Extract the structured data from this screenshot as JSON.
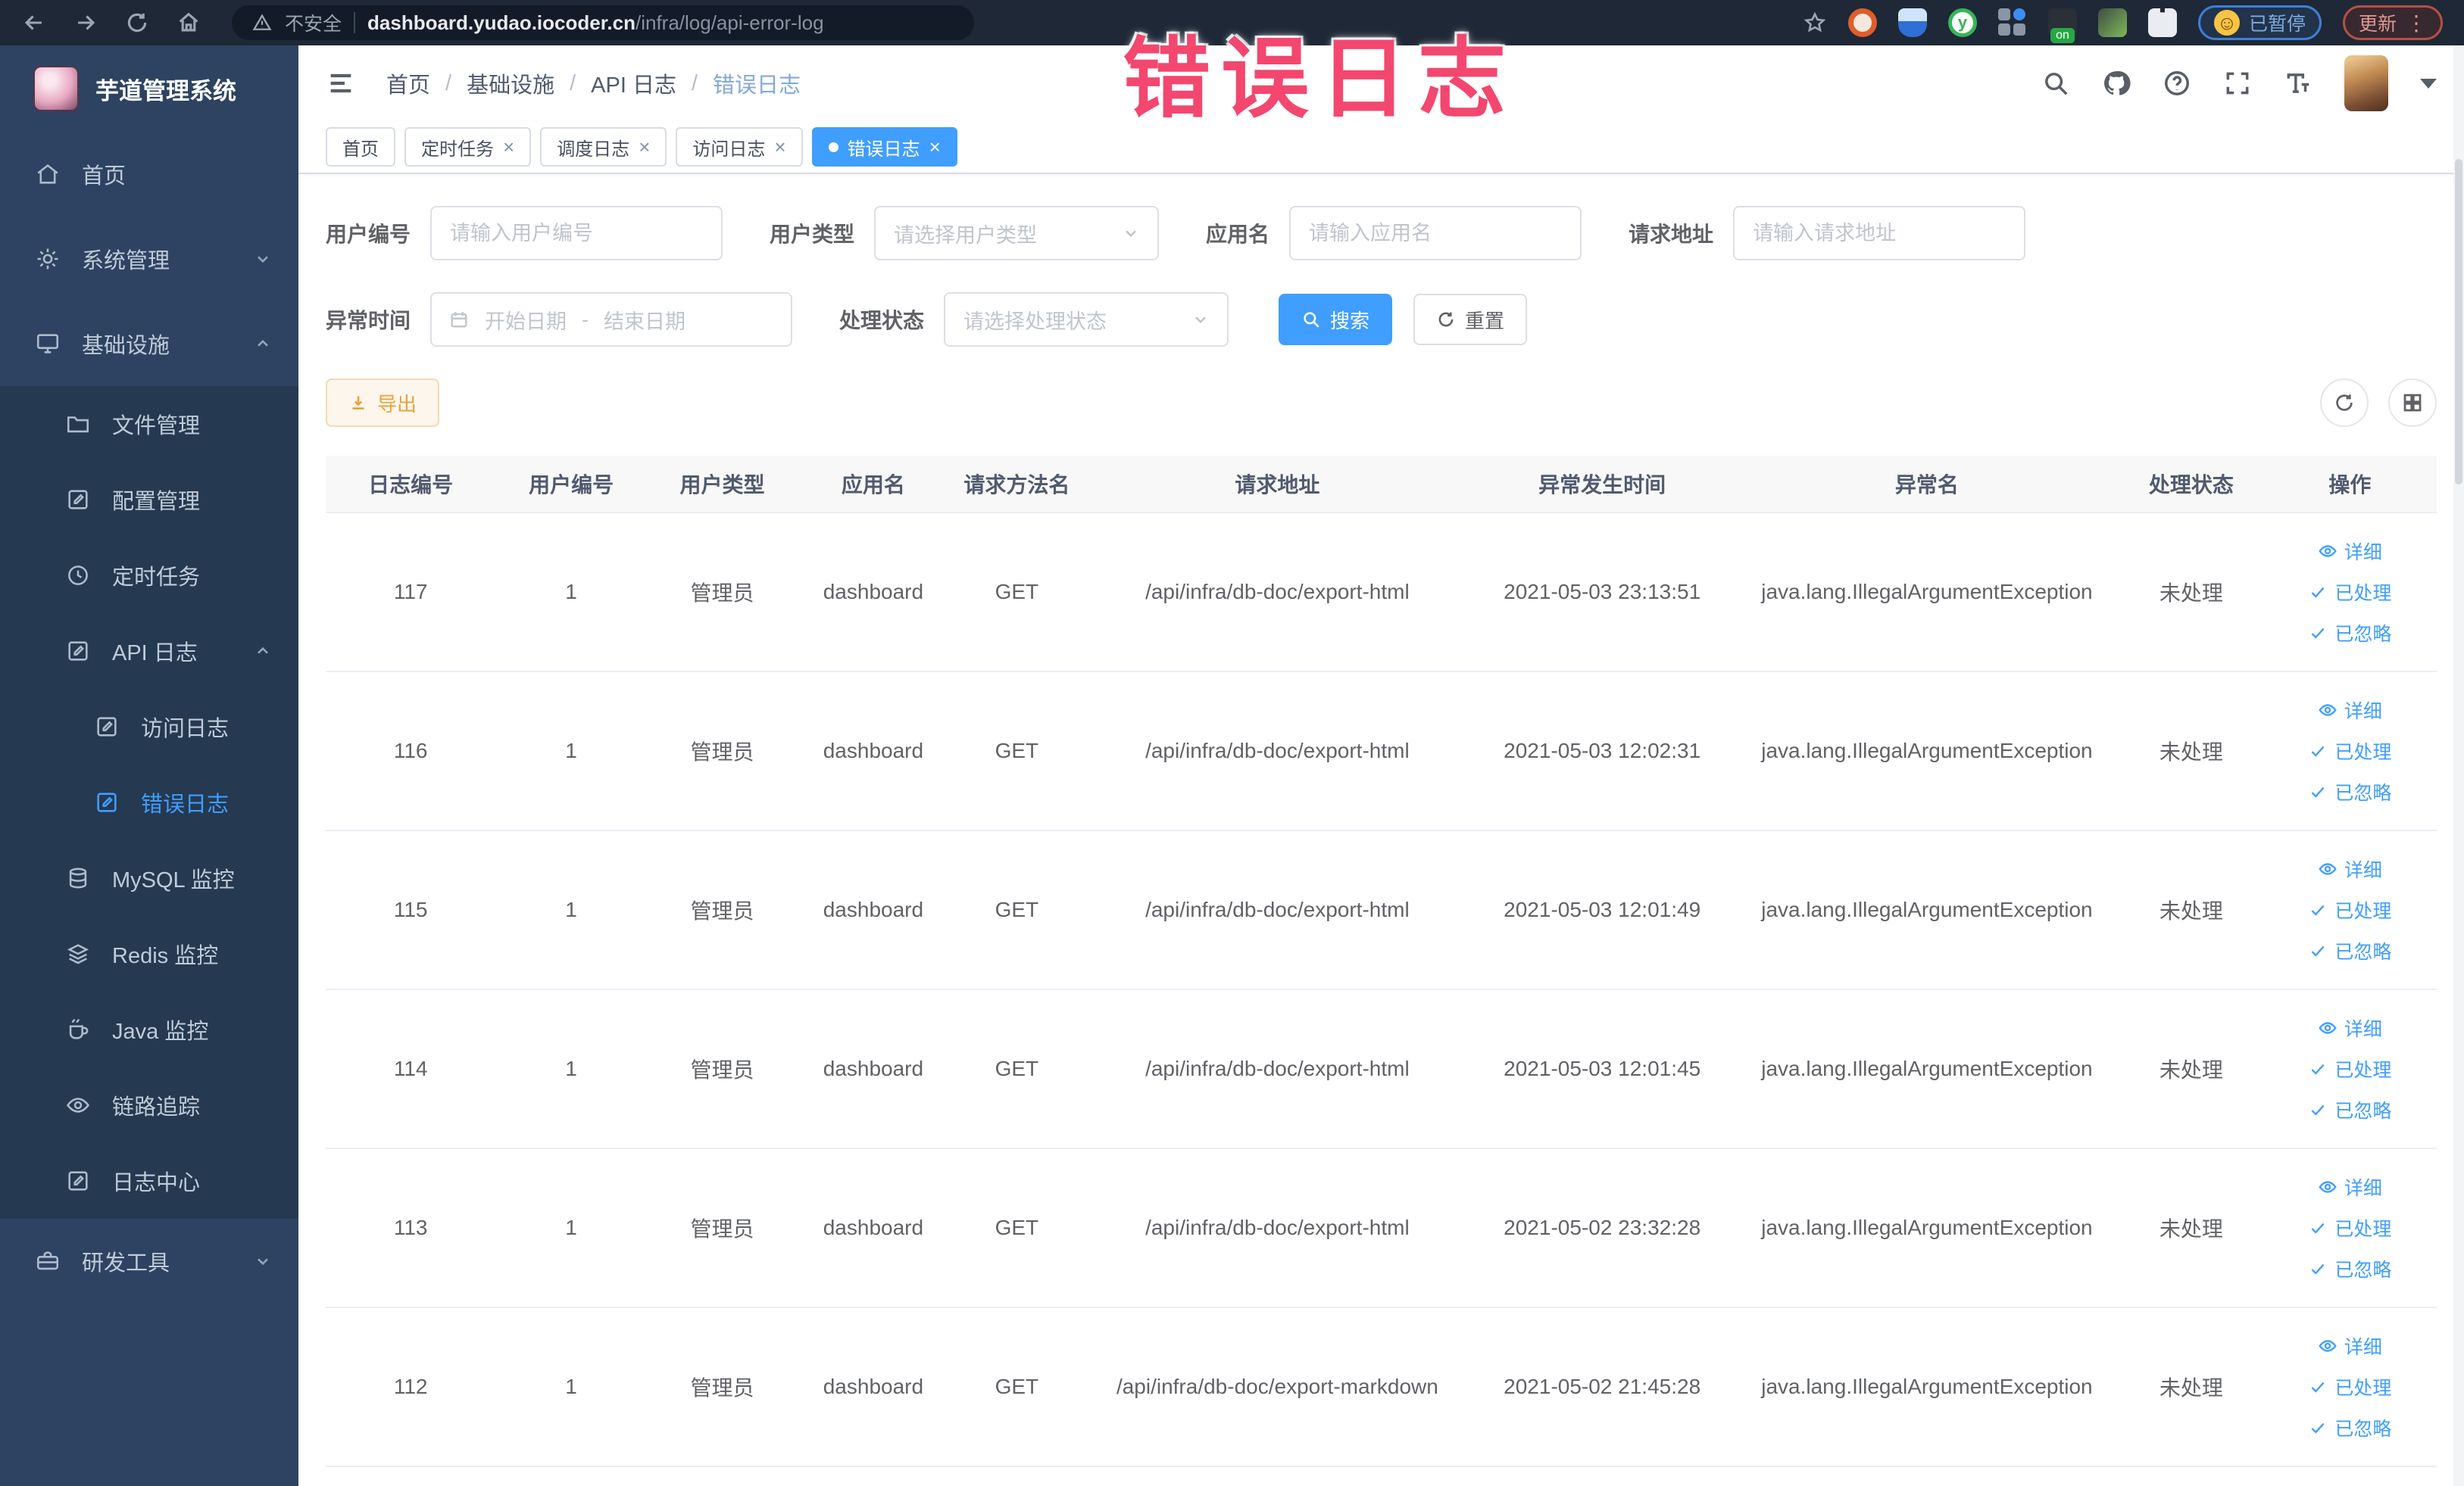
{
  "overlay": {
    "text": "错误日志"
  },
  "browser": {
    "security_text": "不安全",
    "url_host": "dashboard.yudao.iocoder.cn",
    "url_path": "/infra/log/api-error-log",
    "paused_label": "已暂停",
    "update_label": "更新"
  },
  "sidebar": {
    "app_title": "芋道管理系统",
    "items": [
      {
        "label": "首页"
      },
      {
        "label": "系统管理"
      },
      {
        "label": "基础设施"
      },
      {
        "label": "文件管理"
      },
      {
        "label": "配置管理"
      },
      {
        "label": "定时任务"
      },
      {
        "label": "API 日志"
      },
      {
        "label": "访问日志"
      },
      {
        "label": "错误日志"
      },
      {
        "label": "MySQL 监控"
      },
      {
        "label": "Redis 监控"
      },
      {
        "label": "Java 监控"
      },
      {
        "label": "链路追踪"
      },
      {
        "label": "日志中心"
      },
      {
        "label": "研发工具"
      }
    ]
  },
  "breadcrumb": {
    "separator": "/",
    "items": [
      "首页",
      "基础设施",
      "API 日志",
      "错误日志"
    ]
  },
  "tags": [
    {
      "label": "首页"
    },
    {
      "label": "定时任务"
    },
    {
      "label": "调度日志"
    },
    {
      "label": "访问日志"
    },
    {
      "label": "错误日志"
    }
  ],
  "filters": {
    "user_id_label": "用户编号",
    "user_id_placeholder": "请输入用户编号",
    "user_type_label": "用户类型",
    "user_type_placeholder": "请选择用户类型",
    "app_name_label": "应用名",
    "app_name_placeholder": "请输入应用名",
    "request_url_label": "请求地址",
    "request_url_placeholder": "请输入请求地址",
    "time_label": "异常时间",
    "time_start_placeholder": "开始日期",
    "time_separator": "-",
    "time_end_placeholder": "结束日期",
    "status_label": "处理状态",
    "status_placeholder": "请选择处理状态",
    "search_label": "搜索",
    "reset_label": "重置"
  },
  "toolbar": {
    "export_label": "导出"
  },
  "table": {
    "columns": [
      "日志编号",
      "用户编号",
      "用户类型",
      "应用名",
      "请求方法名",
      "请求地址",
      "异常发生时间",
      "异常名",
      "处理状态",
      "操作"
    ],
    "actions": {
      "detail": "详细",
      "processed": "已处理",
      "ignored": "已忽略"
    },
    "rows": [
      {
        "id": "117",
        "user_id": "1",
        "user_type": "管理员",
        "app": "dashboard",
        "method": "GET",
        "url": "/api/infra/db-doc/export-html",
        "time": "2021-05-03 23:13:51",
        "exception": "java.lang.IllegalArgumentException",
        "status": "未处理"
      },
      {
        "id": "116",
        "user_id": "1",
        "user_type": "管理员",
        "app": "dashboard",
        "method": "GET",
        "url": "/api/infra/db-doc/export-html",
        "time": "2021-05-03 12:02:31",
        "exception": "java.lang.IllegalArgumentException",
        "status": "未处理"
      },
      {
        "id": "115",
        "user_id": "1",
        "user_type": "管理员",
        "app": "dashboard",
        "method": "GET",
        "url": "/api/infra/db-doc/export-html",
        "time": "2021-05-03 12:01:49",
        "exception": "java.lang.IllegalArgumentException",
        "status": "未处理"
      },
      {
        "id": "114",
        "user_id": "1",
        "user_type": "管理员",
        "app": "dashboard",
        "method": "GET",
        "url": "/api/infra/db-doc/export-html",
        "time": "2021-05-03 12:01:45",
        "exception": "java.lang.IllegalArgumentException",
        "status": "未处理"
      },
      {
        "id": "113",
        "user_id": "1",
        "user_type": "管理员",
        "app": "dashboard",
        "method": "GET",
        "url": "/api/infra/db-doc/export-html",
        "time": "2021-05-02 23:32:28",
        "exception": "java.lang.IllegalArgumentException",
        "status": "未处理"
      },
      {
        "id": "112",
        "user_id": "1",
        "user_type": "管理员",
        "app": "dashboard",
        "method": "GET",
        "url": "/api/infra/db-doc/export-markdown",
        "time": "2021-05-02 21:45:28",
        "exception": "java.lang.IllegalArgumentException",
        "status": "未处理"
      }
    ]
  },
  "colors": {
    "accent": "#409eff",
    "warning": "#e6a23c",
    "overlay_pink": "#f3476f",
    "sidebar_bg": "#2e4361",
    "sidebar_sub_bg": "#253951"
  }
}
